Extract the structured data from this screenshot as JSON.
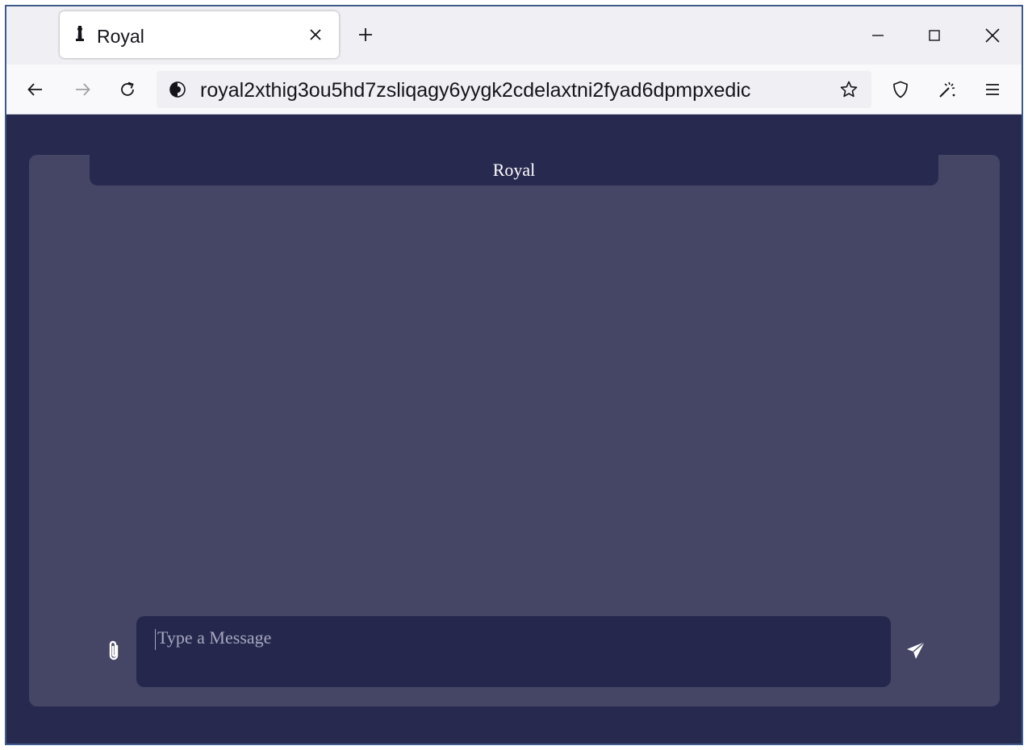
{
  "browser": {
    "tab": {
      "title": "Royal",
      "icon": "chess-pawn-icon"
    },
    "new_tab_icon": "plus-icon",
    "window_controls": [
      "minimize-icon",
      "maximize-icon",
      "close-icon"
    ],
    "navigation": {
      "back_icon": "arrow-left-icon",
      "forward_icon": "arrow-right-icon",
      "reload_icon": "reload-icon"
    },
    "address_bar": {
      "site_icon": "onion-icon",
      "url": "royal2xthig3ou5hd7zsliqagy6yygk2cdelaxtni2fyad6dpmpxedic",
      "bookmark_icon": "star-icon"
    },
    "toolbar_icons": [
      "shield-icon",
      "magic-wand-icon",
      "menu-icon"
    ]
  },
  "chat": {
    "title": "Royal",
    "input": {
      "placeholder": "Type a Message",
      "value": ""
    },
    "attach_icon": "paperclip-icon",
    "send_icon": "send-icon"
  },
  "colors": {
    "page_background": "#27294f",
    "panel_background": "#454566",
    "input_background": "#25274c",
    "text_light": "#ffffff"
  }
}
